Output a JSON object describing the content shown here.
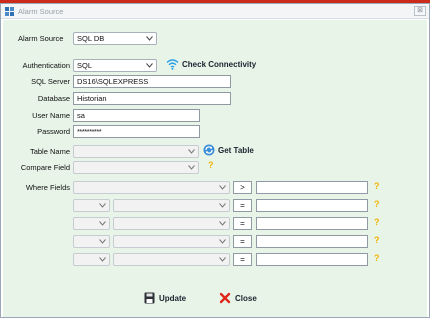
{
  "window": {
    "title": "Alarm Source",
    "close_glyph": "⊠"
  },
  "form": {
    "alarm_source": {
      "label": "Alarm Source",
      "value": "SQL DB"
    },
    "authentication": {
      "label": "Authentication",
      "value": "SQL"
    },
    "check_connectivity": {
      "label": "Check Connectivity",
      "icon": "wifi-icon"
    },
    "sql_server": {
      "label": "SQL Server",
      "value": "DS16\\SQLEXPRESS"
    },
    "database": {
      "label": "Database",
      "value": "Historian"
    },
    "user_name": {
      "label": "User Name",
      "value": "sa"
    },
    "password": {
      "label": "Password",
      "value": "**********"
    },
    "table_name": {
      "label": "Table Name",
      "value": ""
    },
    "get_table": {
      "label": "Get Table",
      "icon": "refresh-icon"
    },
    "compare_field": {
      "label": "Compare Field",
      "value": "",
      "hint": "?"
    },
    "where_fields": {
      "label": "Where Fields",
      "rows": [
        {
          "operator": ">",
          "hint": "?"
        },
        {
          "operator": "=",
          "hint": "?"
        },
        {
          "operator": "=",
          "hint": "?"
        },
        {
          "operator": "=",
          "hint": "?"
        },
        {
          "operator": "=",
          "hint": "?"
        }
      ]
    }
  },
  "buttons": {
    "update": {
      "label": "Update",
      "icon": "save-icon"
    },
    "close": {
      "label": "Close",
      "icon": "close-x-icon"
    }
  },
  "colors": {
    "form_background": "#e8f4e8",
    "top_strip": "#cc2a1a",
    "hint": "#f0b400",
    "wifi": "#2aa0e6",
    "close_red": "#e0261a"
  }
}
